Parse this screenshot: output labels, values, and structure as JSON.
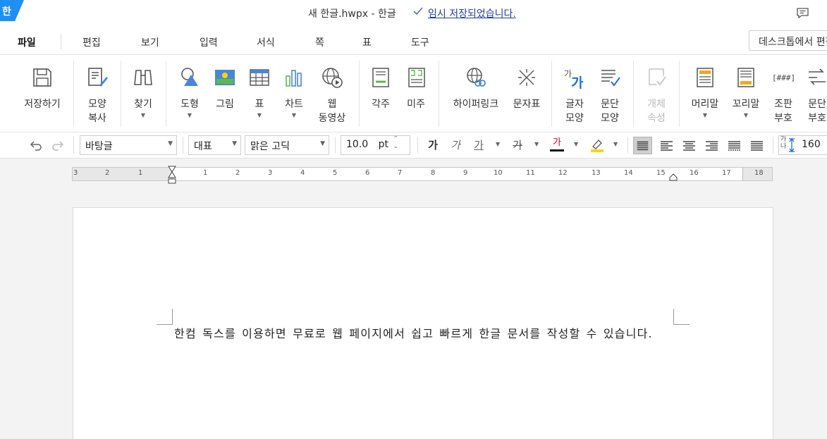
{
  "titlebar": {
    "logo": "한",
    "title": "새 한글.hwpx - 한글",
    "save_status": "임시 저장되었습니다.",
    "icons": [
      "check-icon",
      "comment-icon"
    ]
  },
  "menu": {
    "items": [
      "파일",
      "편집",
      "보기",
      "입력",
      "서식",
      "쪽",
      "표",
      "도구"
    ],
    "desktop_button": "데스크톱에서 편집"
  },
  "ribbon": {
    "save": "저장하기",
    "copy_format": "모양\n복사",
    "find": "찾기",
    "shape": "도형",
    "picture": "그림",
    "table": "표",
    "chart": "차트",
    "web_video": "웹\n동영상",
    "footnote": "각주",
    "endnote": "미주",
    "hyperlink": "하이퍼링크",
    "char_map": "문자표",
    "char_shape": "글자\n모양",
    "para_shape": "문단\n모양",
    "object_props": "개체\n속성",
    "header": "머리말",
    "footer": "꼬리말",
    "compose_code": "조판\n부호",
    "para_code": "문단\n부호"
  },
  "format": {
    "style": "바탕글",
    "font_lang": "대표",
    "font": "맑은 고딕",
    "size": "10.0",
    "size_unit": "pt",
    "bold": "가",
    "italic": "가",
    "underline": "가",
    "strike": "가",
    "color": "가",
    "line_spacing": "160",
    "line_spacing_icon": "가\n나",
    "colors": {
      "font_color": "#d0021b",
      "highlight": "#f5d60a"
    }
  },
  "ruler": {
    "left_numbers": [
      "3",
      "2",
      "1"
    ],
    "numbers": [
      "1",
      "2",
      "3",
      "4",
      "5",
      "6",
      "7",
      "8",
      "9",
      "10",
      "11",
      "12",
      "13",
      "14",
      "15",
      "16",
      "17",
      "18"
    ]
  },
  "document": {
    "text": "한컴 독스를 이용하면 무료로 웹 페이지에서 쉽고 빠르게 한글 문서를 작성할 수 있습니다."
  }
}
